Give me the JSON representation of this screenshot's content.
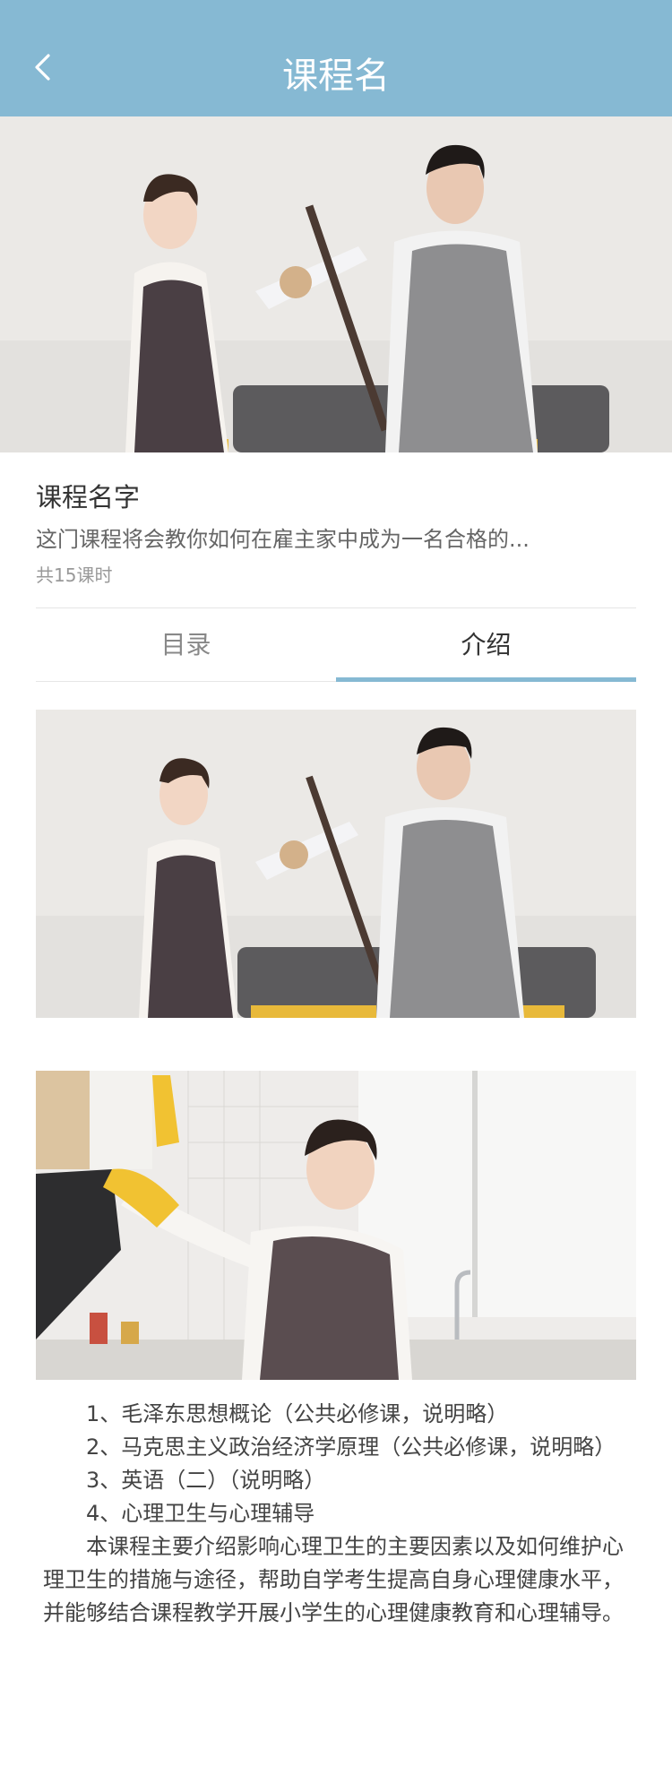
{
  "navbar": {
    "title": "课程名",
    "back_icon": "chevron-left-icon"
  },
  "course": {
    "name": "课程名字",
    "description": "这门课程将会教你如何在雇主家中成为一名合格的...",
    "lesson_count": "共15课时"
  },
  "tabs": [
    {
      "label": "目录",
      "active": false
    },
    {
      "label": "介绍",
      "active": true
    }
  ],
  "content": {
    "items": [
      "1、毛泽东思想概论（公共必修课，说明略）",
      "2、马克思主义政治经济学原理（公共必修课，说明略）",
      "3、英语（二）（说明略）",
      "4、心理卫生与心理辅导"
    ],
    "summary": "本课程主要介绍影响心理卫生的主要因素以及如何维护心理卫生的措施与途径，帮助自学考生提高自身心理健康水平，并能够结合课程教学开展小学生的心理健康教育和心理辅导。"
  },
  "colors": {
    "accent": "#86b9d3",
    "text_primary": "#333333",
    "text_secondary": "#666666",
    "text_muted": "#999999"
  }
}
